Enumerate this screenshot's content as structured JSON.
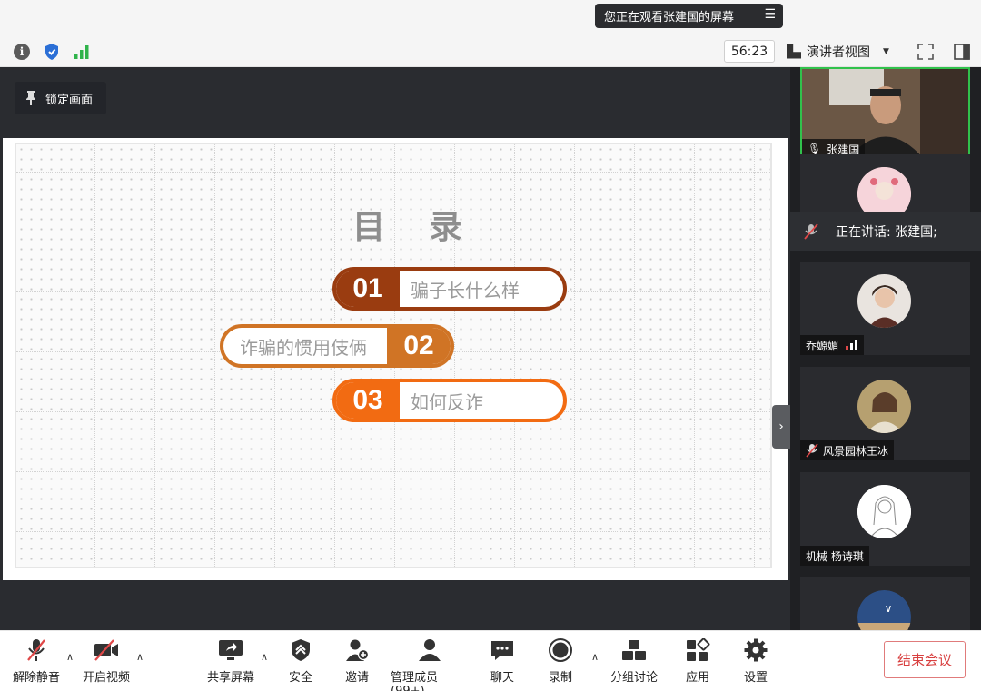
{
  "banner": {
    "text": "您正在观看张建国的屏幕",
    "icon": "menu-icon"
  },
  "header": {
    "timer": "56:23",
    "view_mode": "演讲者视图"
  },
  "stage": {
    "lock_label": "锁定画面",
    "slide": {
      "title": "目 录",
      "items": [
        {
          "num": "01",
          "text": "骗子长什么样",
          "color": "#9a3c10"
        },
        {
          "num": "02",
          "text": "诈骗的惯用伎俩",
          "color": "#d07425"
        },
        {
          "num": "03",
          "text": "如何反诈",
          "color": "#f26b12"
        }
      ]
    }
  },
  "participants": {
    "speaking_text": "正在讲话: 张建国;",
    "tiles": [
      {
        "name": "张建国"
      },
      {
        "name": ""
      },
      {
        "name": "乔嫄媚"
      },
      {
        "name": "风景园林王冰"
      },
      {
        "name": "机械 杨诗琪"
      },
      {
        "name": ""
      }
    ]
  },
  "toolbar": {
    "unmute": "解除静音",
    "start_video": "开启视频",
    "share_screen": "共享屏幕",
    "security": "安全",
    "invite": "邀请",
    "manage_members": "管理成员(99+)",
    "chat": "聊天",
    "record": "录制",
    "breakout": "分组讨论",
    "apps": "应用",
    "settings": "设置",
    "end_meeting": "结束会议"
  },
  "colors": {
    "accent_red": "#d84040",
    "stage_bg": "#2a2c30",
    "panel_bg": "#1f2023"
  }
}
